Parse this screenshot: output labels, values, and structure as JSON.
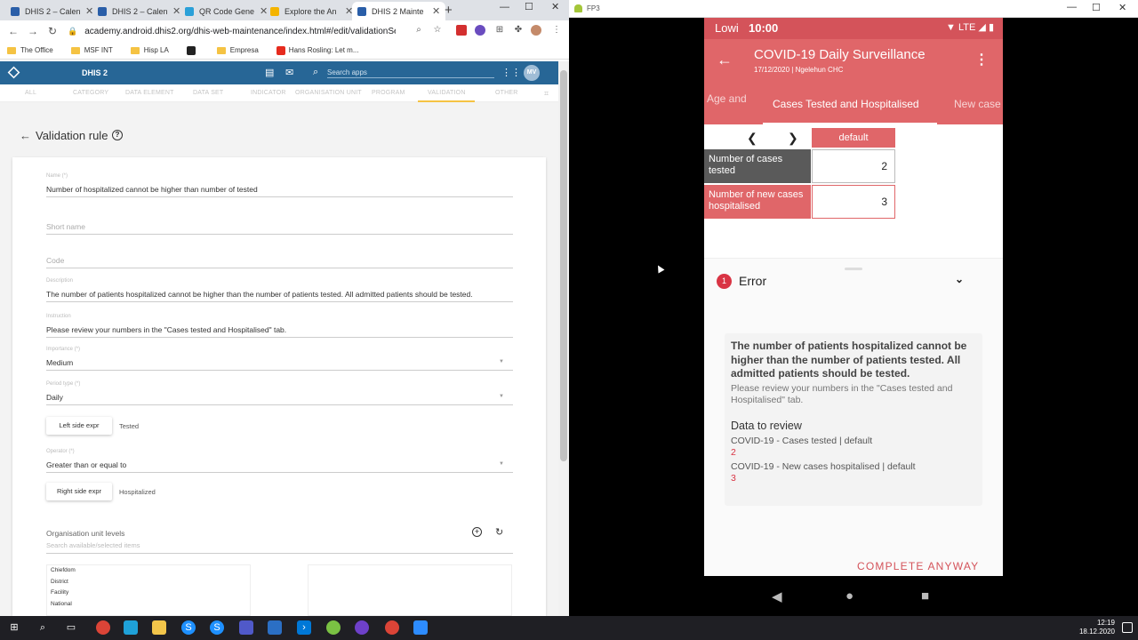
{
  "browser": {
    "tabs": [
      {
        "title": "DHIS 2 – Calen",
        "color": "#2a5ea8"
      },
      {
        "title": "DHIS 2 – Calen",
        "color": "#2a5ea8"
      },
      {
        "title": "QR Code Gene",
        "color": "#2aa0d8"
      },
      {
        "title": "Explore the An",
        "color": "#f4b400"
      },
      {
        "title": "DHIS 2 Mainte",
        "color": "#2a5ea8"
      }
    ],
    "url": "academy.android.dhis2.org/dhis-web-maintenance/index.html#/edit/validationSectio...",
    "bookmarks": [
      "The Office",
      "MSF INT",
      "Hisp LA",
      "Empresa",
      "Hans Rosling: Let m..."
    ]
  },
  "dhis": {
    "title": "DHIS 2",
    "search_placeholder": "Search apps",
    "avatar": "MV",
    "sections": [
      "ALL",
      "CATEGORY",
      "DATA ELEMENT",
      "DATA SET",
      "INDICATOR",
      "ORGANISATION UNIT",
      "PROGRAM",
      "VALIDATION",
      "OTHER"
    ],
    "page_title": "Validation rule",
    "form": {
      "name_label": "Name (*)",
      "name_value": "Number of hospitalized cannot be higher than number of tested",
      "short_name_placeholder": "Short name",
      "code_placeholder": "Code",
      "description_label": "Description",
      "description_value": "The number of patients hospitalized cannot be higher than the number of patients tested. All admitted patients should be tested.",
      "instruction_label": "Instruction",
      "instruction_value": "Please review your numbers in the \"Cases tested and Hospitalised\" tab.",
      "importance_label": "Importance (*)",
      "importance_value": "Medium",
      "period_label": "Period type (*)",
      "period_value": "Daily",
      "left_btn": "Left side expr",
      "left_value": "Tested",
      "operator_label": "Operator (*)",
      "operator_value": "Greater than or equal to",
      "right_btn": "Right side expr",
      "right_value": "Hospitalized",
      "org_title": "Organisation unit levels",
      "org_search_placeholder": "Search available/selected items",
      "org_levels": [
        "Chiefdom",
        "District",
        "Facility",
        "National"
      ]
    }
  },
  "emulator": {
    "window_title": "FP3",
    "status": {
      "carrier": "Lowi",
      "time": "10:00",
      "network": "LTE"
    },
    "appbar": {
      "title": "COVID-19 Daily Surveillance",
      "subtitle": "17/12/2020 | Ngelehun CHC"
    },
    "tabs": [
      "Age and",
      "Cases Tested and Hospitalised",
      "New case"
    ],
    "table": {
      "column": "default",
      "rows": [
        {
          "label": "Number of cases tested",
          "value": "2",
          "color": "#5a5a5a"
        },
        {
          "label": "Number of new cases hospitalised",
          "value": "3",
          "color": "#e06669"
        }
      ]
    },
    "error": {
      "count": "1",
      "title": "Error",
      "message": "The number of patients hospitalized cannot be higher than the number of patients tested. All admitted patients should be tested.",
      "instruction": "Please review your numbers in the \"Cases tested and Hospitalised\" tab.",
      "review_title": "Data to review",
      "items": [
        {
          "label": "COVID-19 - Cases tested | default",
          "value": "2"
        },
        {
          "label": "COVID-19 - New cases hospitalised | default",
          "value": "3"
        }
      ],
      "action": "COMPLETE ANYWAY"
    }
  },
  "taskbar": {
    "time": "12:19",
    "date": "18.12.2020"
  },
  "colors": {
    "dhis_blue": "#276696",
    "app_red": "#e06669",
    "error_red": "#d93444"
  }
}
